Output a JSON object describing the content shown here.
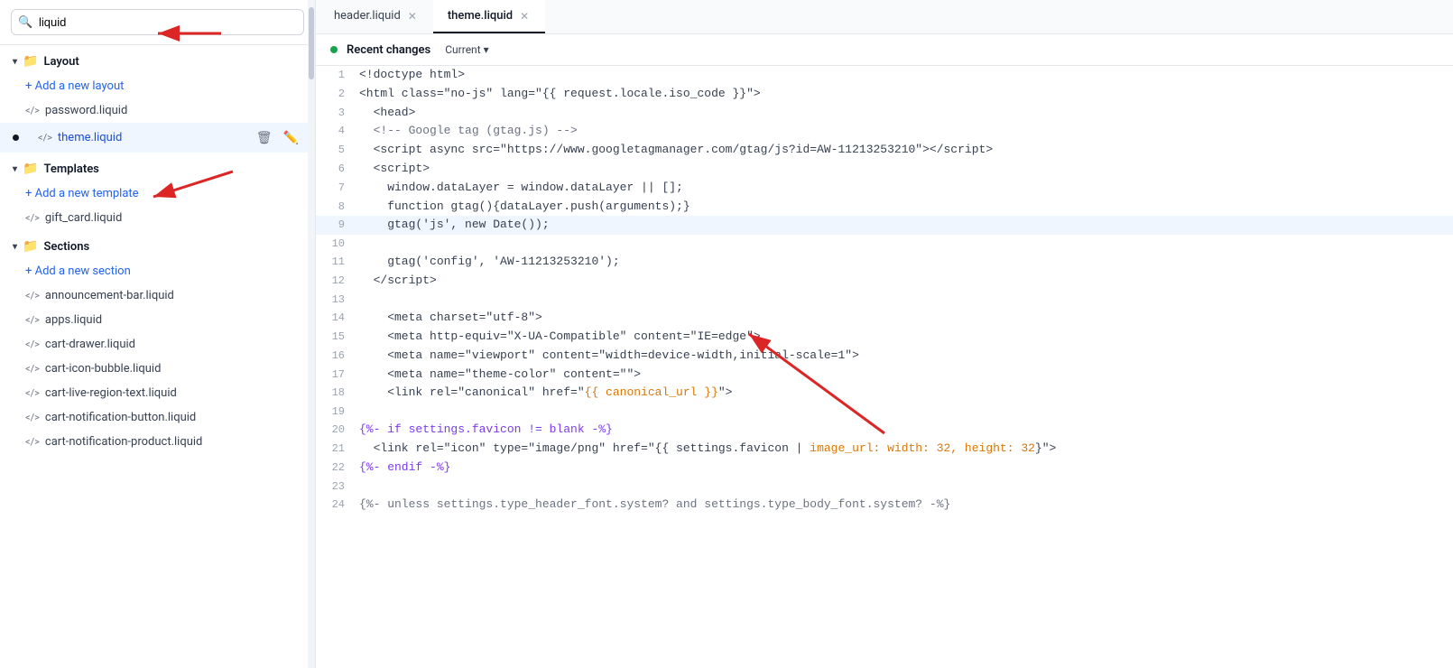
{
  "sidebar": {
    "search": {
      "value": "liquid",
      "placeholder": "liquid"
    },
    "layout": {
      "header": "Layout",
      "add_label": "+ Add a new layout",
      "items": [
        {
          "name": "password.liquid",
          "active": false,
          "dot": false
        },
        {
          "name": "theme.liquid",
          "active": true,
          "dot": true
        }
      ]
    },
    "templates": {
      "header": "Templates",
      "add_label": "+ Add a new template",
      "items": [
        {
          "name": "gift_card.liquid",
          "active": false,
          "dot": false
        }
      ]
    },
    "sections": {
      "header": "Sections",
      "add_label": "+ Add a new section",
      "items": [
        {
          "name": "announcement-bar.liquid",
          "active": false
        },
        {
          "name": "apps.liquid",
          "active": false
        },
        {
          "name": "cart-drawer.liquid",
          "active": false
        },
        {
          "name": "cart-icon-bubble.liquid",
          "active": false
        },
        {
          "name": "cart-live-region-text.liquid",
          "active": false
        },
        {
          "name": "cart-notification-button.liquid",
          "active": false
        },
        {
          "name": "cart-notification-product.liquid",
          "active": false
        }
      ]
    }
  },
  "editor": {
    "tabs": [
      {
        "label": "header.liquid",
        "active": false
      },
      {
        "label": "theme.liquid",
        "active": true
      }
    ],
    "recent_changes": {
      "label": "Recent changes",
      "current": "Current"
    },
    "lines": [
      {
        "num": 1,
        "tokens": [
          {
            "t": "default",
            "v": "<!doctype html>"
          }
        ]
      },
      {
        "num": 2,
        "tokens": [
          {
            "t": "default",
            "v": "<html class=\"no-js\" lang=\"{{ request.locale.iso_code }}\">"
          }
        ]
      },
      {
        "num": 3,
        "tokens": [
          {
            "t": "default",
            "v": "  <head>"
          }
        ]
      },
      {
        "num": 4,
        "tokens": [
          {
            "t": "comment",
            "v": "  <!-- Google tag (gtag.js) -->"
          }
        ]
      },
      {
        "num": 5,
        "tokens": [
          {
            "t": "default",
            "v": "  <script async src=\"https://www.googletagmanager.com/gtag/js?id=AW-11213253210\"></script>"
          }
        ]
      },
      {
        "num": 6,
        "tokens": [
          {
            "t": "default",
            "v": "  <script>"
          }
        ]
      },
      {
        "num": 7,
        "tokens": [
          {
            "t": "js",
            "v": "    window.dataLayer = window.dataLayer || [];"
          }
        ]
      },
      {
        "num": 8,
        "tokens": [
          {
            "t": "js",
            "v": "    function gtag(){dataLayer.push(arguments);}"
          }
        ]
      },
      {
        "num": 9,
        "tokens": [
          {
            "t": "js",
            "v": "    gtag('js', new Date());"
          }
        ],
        "highlighted": true
      },
      {
        "num": 10,
        "tokens": [
          {
            "t": "default",
            "v": ""
          }
        ]
      },
      {
        "num": 11,
        "tokens": [
          {
            "t": "js",
            "v": "    gtag('config', 'AW-11213253210');"
          }
        ]
      },
      {
        "num": 12,
        "tokens": [
          {
            "t": "default",
            "v": "  </script>"
          }
        ]
      },
      {
        "num": 13,
        "tokens": [
          {
            "t": "default",
            "v": ""
          }
        ]
      },
      {
        "num": 14,
        "tokens": [
          {
            "t": "default",
            "v": "    <meta charset=\"utf-8\">"
          }
        ]
      },
      {
        "num": 15,
        "tokens": [
          {
            "t": "default",
            "v": "    <meta http-equiv=\"X-UA-Compatible\" content=\"IE=edge\">"
          }
        ]
      },
      {
        "num": 16,
        "tokens": [
          {
            "t": "default",
            "v": "    <meta name=\"viewport\" content=\"width=device-width,initial-scale=1\">"
          }
        ]
      },
      {
        "num": 17,
        "tokens": [
          {
            "t": "default",
            "v": "    <meta name=\"theme-color\" content=\"\">"
          }
        ]
      },
      {
        "num": 18,
        "tokens": [
          {
            "t": "default",
            "v": "    <link rel=\"canonical\" href=\""
          },
          {
            "t": "liquid",
            "v": "{{ canonical_url }}"
          },
          {
            "t": "default",
            "v": "\">"
          }
        ]
      },
      {
        "num": 19,
        "tokens": [
          {
            "t": "default",
            "v": ""
          }
        ]
      },
      {
        "num": 20,
        "tokens": [
          {
            "t": "keyword",
            "v": "{%- if settings.favicon != blank -%}"
          }
        ]
      },
      {
        "num": 21,
        "tokens": [
          {
            "t": "default",
            "v": "  <link rel=\"icon\" type=\"image/png\" href=\"{{ settings.favicon | "
          },
          {
            "t": "liquid",
            "v": "image_url: width: 32, height: 32"
          },
          {
            "t": "default",
            "v": "}\">"
          }
        ]
      },
      {
        "num": 22,
        "tokens": [
          {
            "t": "keyword",
            "v": "{%- endif -%}"
          }
        ]
      },
      {
        "num": 23,
        "tokens": [
          {
            "t": "default",
            "v": ""
          }
        ]
      },
      {
        "num": 24,
        "tokens": [
          {
            "t": "comment",
            "v": "{%- unless settings.type_header_font.system? and settings.type_body_font.system? -%}"
          }
        ]
      }
    ]
  }
}
